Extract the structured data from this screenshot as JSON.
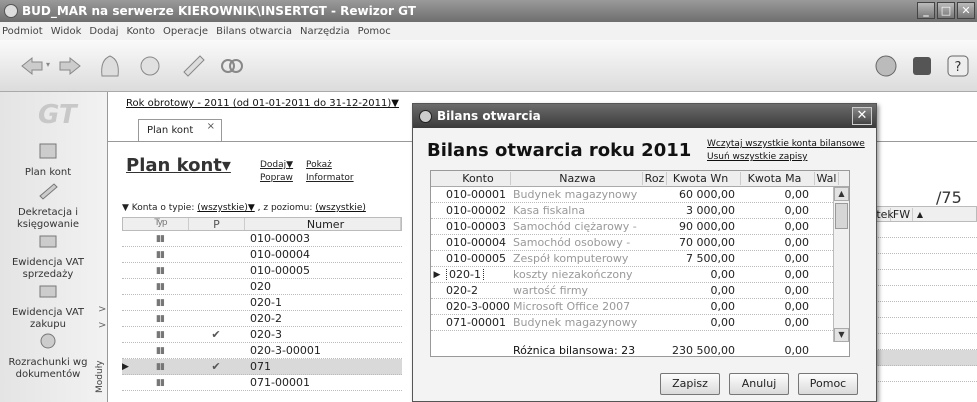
{
  "window": {
    "title": "BUD_MAR na serwerze KIEROWNIK\\INSERTGT - Rewizor GT",
    "buttons": [
      "_",
      "□",
      "✕"
    ]
  },
  "menu": [
    "Podmiot",
    "Widok",
    "Dodaj",
    "Konto",
    "Operacje",
    "Bilans otwarcia",
    "Narzędzia",
    "Pomoc"
  ],
  "sidebar": {
    "logo": "GT",
    "items": [
      {
        "label": "Plan kont",
        "icon": "plan-kont-icon"
      },
      {
        "label": "Dekretacja i księgowanie",
        "icon": "dekretacja-icon"
      },
      {
        "label": "Ewidencja VAT sprzedaży",
        "icon": "vat-sprzedaz-icon"
      },
      {
        "label": "Ewidencja VAT zakupu",
        "icon": "vat-zakup-icon"
      },
      {
        "label": "Rozrachunki wg dokumentów",
        "icon": "rozrachunki-icon"
      }
    ],
    "modules_tab": "Moduły"
  },
  "main": {
    "year_line": "Rok obrotowy - 2011  (od 01-01-2011 do 31-12-2011)▼",
    "tab_label": "Plan kont",
    "title": "Plan kont▾",
    "links": {
      "dodaj": "Dodaj▼",
      "pokaz": "Pokaż",
      "popraw": "Popraw",
      "informator": "Informator"
    },
    "filter": {
      "label": "Konta o typie:",
      "type_value": "(wszystkie)▼",
      "level_label": ", z poziomu:",
      "level_value": "(wszystkie)"
    },
    "columns": [
      "Typ",
      "P",
      "Numer"
    ],
    "rows": [
      {
        "typ": "▮▮",
        "p": "",
        "numer": "010-00003",
        "sel": false
      },
      {
        "typ": "▮▮",
        "p": "",
        "numer": "010-00004",
        "sel": false
      },
      {
        "typ": "▮▮",
        "p": "",
        "numer": "010-00005",
        "sel": false
      },
      {
        "typ": "▮▮",
        "p": "",
        "numer": "020",
        "sel": false
      },
      {
        "typ": "▮▮",
        "p": "",
        "numer": "020-1",
        "sel": false
      },
      {
        "typ": "▮▮",
        "p": "",
        "numer": "020-2",
        "sel": false
      },
      {
        "typ": "▮▮",
        "p": "✔",
        "numer": "020-3",
        "sel": false
      },
      {
        "typ": "▮▮",
        "p": "",
        "numer": "020-3-00001",
        "sel": false
      },
      {
        "typ": "▮▮",
        "p": "✔",
        "numer": "071",
        "sel": true
      },
      {
        "typ": "▮▮",
        "p": "",
        "numer": "071-00001",
        "sel": false
      }
    ],
    "right_number": "/75",
    "right_columns": [
      "Kartotek",
      "FW"
    ],
    "right_rows": [
      "✔",
      "✔",
      "✔",
      "",
      "",
      "",
      "",
      "✔",
      "",
      "✔"
    ]
  },
  "dialog": {
    "title": "Bilans otwarcia",
    "heading": "Bilans otwarcia roku 2011",
    "link_load": "Wczytaj wszystkie konta bilansowe",
    "link_delete": "Usuń wszystkie zapisy",
    "columns": [
      "Konto",
      "Nazwa",
      "Roz",
      "Kwota Wn",
      "Kwota Ma",
      "Wal"
    ],
    "rows": [
      {
        "konto": "010-00001",
        "nazwa": "Budynek magazynowy",
        "wn": "60 000,00",
        "ma": "0,00",
        "cur": false
      },
      {
        "konto": "010-00002",
        "nazwa": "Kasa fiskalna",
        "wn": "3 000,00",
        "ma": "0,00",
        "cur": false
      },
      {
        "konto": "010-00003",
        "nazwa": "Samochód ciężarowy -",
        "wn": "90 000,00",
        "ma": "0,00",
        "cur": false
      },
      {
        "konto": "010-00004",
        "nazwa": "Samochód osobowy -",
        "wn": "70 000,00",
        "ma": "0,00",
        "cur": false
      },
      {
        "konto": "010-00005",
        "nazwa": "Zespół komputerowy",
        "wn": "7 500,00",
        "ma": "0,00",
        "cur": false
      },
      {
        "konto": "020-1",
        "nazwa": "koszty niezakończony",
        "wn": "0,00",
        "ma": "0,00",
        "cur": true
      },
      {
        "konto": "020-2",
        "nazwa": "wartość firmy",
        "wn": "0,00",
        "ma": "0,00",
        "cur": false
      },
      {
        "konto": "020-3-0000",
        "nazwa": "Microsoft Office 2007",
        "wn": "0,00",
        "ma": "0,00",
        "cur": false
      },
      {
        "konto": "071-00001",
        "nazwa": "Budynek magazynowy",
        "wn": "0,00",
        "ma": "0,00",
        "cur": false
      }
    ],
    "summary": {
      "label": "Różnica bilansowa: 23",
      "wn": "230 500,00",
      "ma": "0,00"
    },
    "buttons": {
      "save": "Zapisz",
      "cancel": "Anuluj",
      "help": "Pomoc"
    }
  }
}
